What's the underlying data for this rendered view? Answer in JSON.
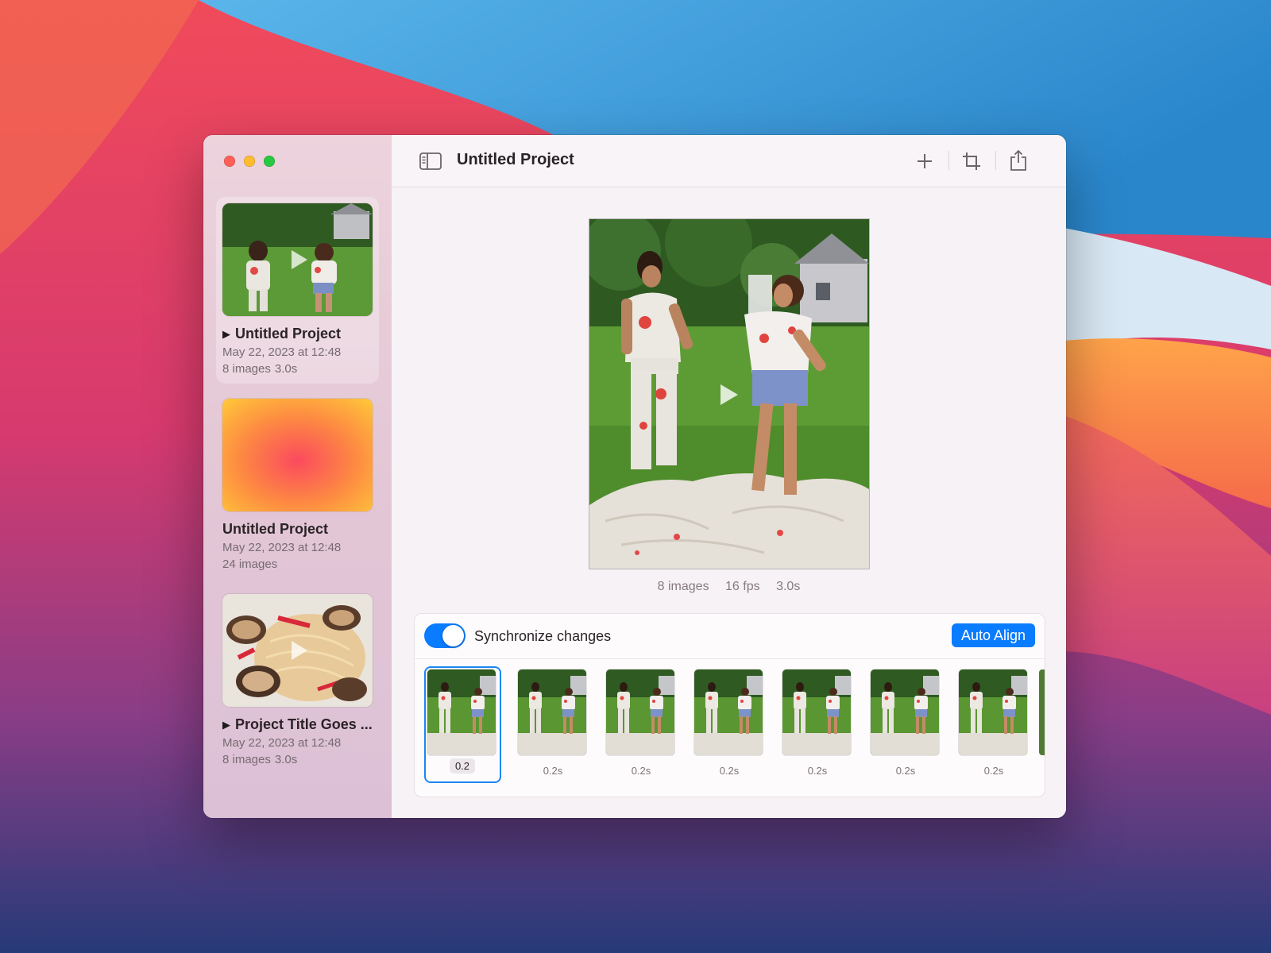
{
  "window": {
    "title": "Untitled Project",
    "traffic_lights": [
      "close",
      "minimize",
      "zoom"
    ]
  },
  "sidebar": {
    "projects": [
      {
        "title": "Untitled Project",
        "date": "May 22, 2023 at 12:48",
        "images": "8 images",
        "duration": "3.0s",
        "has_play": true,
        "thumb": "photo-couple"
      },
      {
        "title": "Untitled Project",
        "date": "May 22, 2023 at 12:48",
        "images": "24 images",
        "duration": "",
        "has_play": false,
        "thumb": "gradient-orange"
      },
      {
        "title": "Project Title Goes ...",
        "date": "May 22, 2023 at 12:48",
        "images": "8 images",
        "duration": "3.0s",
        "has_play": true,
        "thumb": "photo-pasta"
      }
    ]
  },
  "toolbar": {
    "sidebar_icon": "sidebar-toggle-icon",
    "add_icon": "plus-icon",
    "crop_icon": "crop-icon",
    "share_icon": "share-icon"
  },
  "preview": {
    "images": "8 images",
    "fps": "16 fps",
    "duration": "3.0s"
  },
  "panel": {
    "sync_label": "Synchronize changes",
    "sync_on": true,
    "auto_align": "Auto Align",
    "frames": [
      {
        "label": "0.2",
        "selected": true
      },
      {
        "label": "0.2s",
        "selected": false
      },
      {
        "label": "0.2s",
        "selected": false
      },
      {
        "label": "0.2s",
        "selected": false
      },
      {
        "label": "0.2s",
        "selected": false
      },
      {
        "label": "0.2s",
        "selected": false
      },
      {
        "label": "0.2s",
        "selected": false
      }
    ]
  },
  "colors": {
    "accent": "#0a7cff",
    "sidebar": "#e4c8d6",
    "window_bg": "#f7f2f6"
  }
}
